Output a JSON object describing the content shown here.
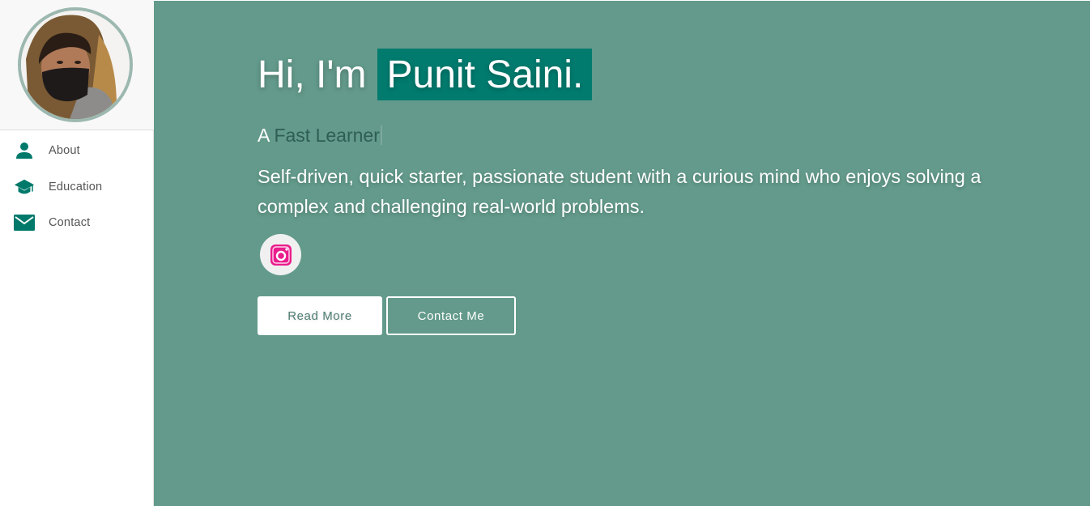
{
  "sidebar": {
    "avatar_alt": "profile photo",
    "items": [
      {
        "label": "About",
        "icon": "person-icon"
      },
      {
        "label": "Education",
        "icon": "graduation-cap-icon"
      },
      {
        "label": "Contact",
        "icon": "mail-icon"
      }
    ],
    "accent_color": "#00796b"
  },
  "hero": {
    "greeting": "Hi, I'm",
    "name": "Punit Saini.",
    "subtitle_prefix": "A",
    "subtitle_typed": "Fast Learner",
    "description": "Self-driven, quick starter, passionate student with a curious mind who enjoys solving a complex and challenging real-world problems.",
    "social": [
      {
        "icon": "instagram-icon",
        "color": "#e91e8c"
      }
    ],
    "background_color": "#639a8b",
    "name_highlight_color": "#007b6e"
  },
  "buttons": {
    "read_more": "Read More",
    "contact_me": "Contact Me"
  }
}
